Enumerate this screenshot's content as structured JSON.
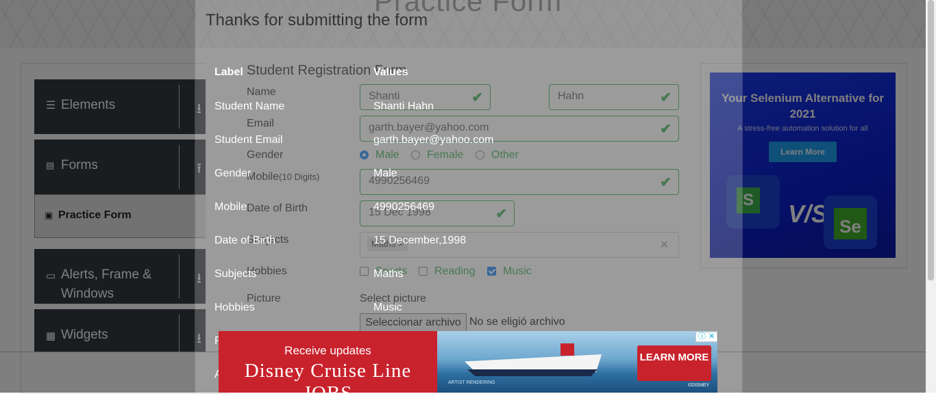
{
  "header": {
    "title": "Practice Form"
  },
  "sidebar": {
    "groups": [
      {
        "label": "Elements",
        "icon": "hamburger-icon",
        "arrow": "chevron-down-icon"
      },
      {
        "label": "Forms",
        "icon": "document-icon",
        "arrow": "chevron-up-icon"
      },
      {
        "label": "Alerts, Frame & Windows",
        "icon": "window-icon",
        "arrow": "chevron-down-icon"
      },
      {
        "label": "Widgets",
        "icon": "widgets-icon",
        "arrow": "chevron-down-icon"
      }
    ],
    "active_item": {
      "label": "Practice Form",
      "icon": "form-icon"
    }
  },
  "form": {
    "title": "Student Registration Form",
    "name_label": "Name",
    "first_name": "Shanti",
    "last_name": "Hahn",
    "email_label": "Email",
    "email": "garth.bayer@yahoo.com",
    "gender_label": "Gender",
    "gender_options": [
      "Male",
      "Female",
      "Other"
    ],
    "gender_selected": "Male",
    "mobile_label": "Mobile",
    "mobile_hint": "(10 Digits)",
    "mobile": "4990256469",
    "dob_label": "Date of Birth",
    "dob": "15 Dec 1998",
    "subjects_label": "Subjects",
    "subject_chip": "Maths",
    "hobbies_label": "Hobbies",
    "hobbies": [
      {
        "label": "Sports",
        "checked": false
      },
      {
        "label": "Reading",
        "checked": false
      },
      {
        "label": "Music",
        "checked": true
      }
    ],
    "picture_label": "Picture",
    "picture_hint": "Select picture",
    "file_button": "Seleccionar archivo",
    "file_status": "No se eligió archivo"
  },
  "modal": {
    "title": "Thanks for submitting the form",
    "headers": {
      "label": "Label",
      "values": "Values"
    },
    "rows": [
      {
        "label": "Student Name",
        "value": "Shanti Hahn"
      },
      {
        "label": "Student Email",
        "value": "garth.bayer@yahoo.com"
      },
      {
        "label": "Gender",
        "value": "Male"
      },
      {
        "label": "Mobile",
        "value": "4990256469"
      },
      {
        "label": "Date of Birth",
        "value": "15 December,1998"
      },
      {
        "label": "Subjects",
        "value": "Maths"
      },
      {
        "label": "Hobbies",
        "value": "Music"
      },
      {
        "label": "P",
        "value": ""
      },
      {
        "label": "A",
        "value": ""
      }
    ]
  },
  "right_ad": {
    "headline": "Your Selenium Alternative for 2021",
    "subtitle": "A stress-free automation solution for all",
    "button": "Learn More",
    "logo_left": "S",
    "vs": "V/S",
    "logo_right": "Se"
  },
  "bottom_ad": {
    "line1": "Receive updates",
    "line2": "Disney Cruise Line JOBS",
    "cta": "LEARN MORE",
    "note": "ARTIST RENDERING",
    "copyright": "©DISNEY",
    "adchoices_icon": "info-icon",
    "close_icon": "close-icon"
  }
}
